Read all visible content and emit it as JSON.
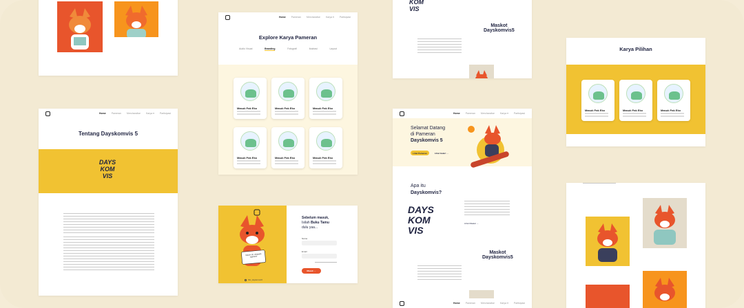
{
  "colors": {
    "accent": "#f1c232",
    "orange": "#e8552c",
    "navy": "#1f2340",
    "cream": "#fdf6e0"
  },
  "nav": {
    "items": [
      "Home",
      "Pameran",
      "Merchandise",
      "Karya ▾",
      "Partisipasi"
    ],
    "active": "Home"
  },
  "explore": {
    "title": "Explore Karya Pameran",
    "tabs": [
      "Audio Visual",
      "Branding",
      "Fotografi",
      "Ilustrasi",
      "Layout"
    ],
    "active_tab": "Branding"
  },
  "karya": {
    "title": "Masuk Pak Eko",
    "meta": "Kategori Nama Kelompok"
  },
  "about": {
    "title": "Tentang Dayskomvis 5",
    "logo_text": "DAYS KOM VIS"
  },
  "maskot": {
    "label": "Maskot",
    "name": "Dayskomvis5"
  },
  "login": {
    "heading_1": "Sebelum masuk,",
    "heading_2": "Isilah ",
    "heading_bold": "Buku Tamu",
    "heading_3": "dulu yaa...",
    "field_name": "Nama",
    "field_email": "Email",
    "submit": "Masuk",
    "sign_text": "Masuk sih, daripada ngetawa!",
    "footer": "Dkv_dayskomvis5"
  },
  "hero": {
    "line1": "Selamat Datang",
    "line2": "di Pameran",
    "bold": "Dayskomvis 5",
    "primary_btn": "Lihat Pameran",
    "secondary_btn": "Lihat Galeri"
  },
  "apa": {
    "line1": "Apa itu",
    "bold": "Dayskomvis?",
    "link": "Lihat Maskot"
  },
  "pilihan": {
    "title": "Karya Pilihan"
  }
}
